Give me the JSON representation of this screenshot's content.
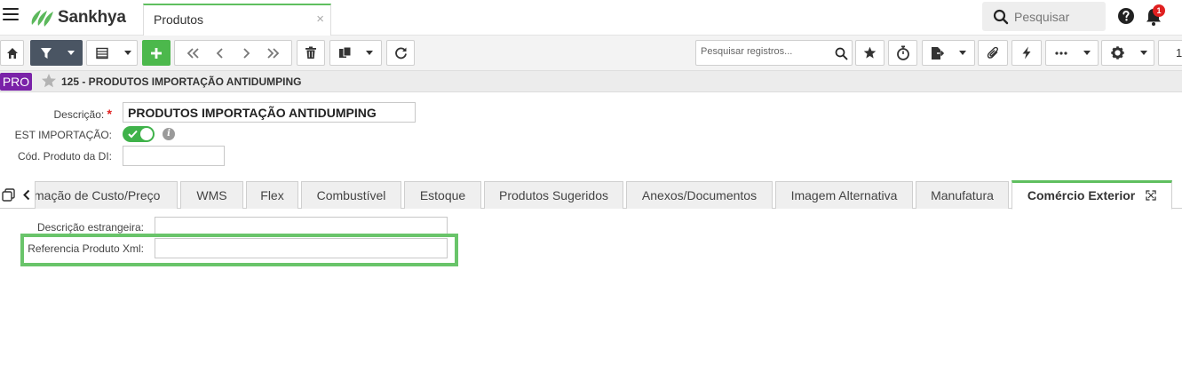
{
  "app": {
    "brand": "Sankhya",
    "tab_title": "Produtos",
    "tab_close": "×",
    "search_placeholder": "Pesquisar",
    "notification_count": "1"
  },
  "toolbar": {
    "records_search_placeholder": "Pesquisar registros...",
    "page_number": "1"
  },
  "record": {
    "badge": "PRO",
    "title": "125 - PRODUTOS IMPORTAÇÃO ANTIDUMPING"
  },
  "form": {
    "descricao_label": "Descrição:",
    "required_mark": "*",
    "descricao_value": "PRODUTOS IMPORTAÇÃO ANTIDUMPING",
    "est_importacao_label": "EST IMPORTAÇÃO:",
    "est_importacao_on": true,
    "info_glyph": "i",
    "cod_produto_di_label": "Cód. Produto da DI:",
    "cod_produto_di_value": ""
  },
  "tabs": [
    {
      "label": "mação de Custo/Preço"
    },
    {
      "label": "WMS"
    },
    {
      "label": "Flex"
    },
    {
      "label": "Combustível"
    },
    {
      "label": "Estoque"
    },
    {
      "label": "Produtos Sugeridos"
    },
    {
      "label": "Anexos/Documentos"
    },
    {
      "label": "Imagem Alternativa"
    },
    {
      "label": "Manufatura"
    },
    {
      "label": "Comércio Exterior"
    }
  ],
  "comercio_exterior": {
    "descricao_estrangeira_label": "Descrição estrangeira:",
    "descricao_estrangeira_value": "",
    "referencia_produto_xml_label": "Referencia Produto Xml:",
    "referencia_produto_xml_value": ""
  },
  "colors": {
    "accent_green": "#4cb84c",
    "badge_purple": "#7a22a8",
    "highlight": "#69c46a",
    "notification_red": "#e02020"
  }
}
